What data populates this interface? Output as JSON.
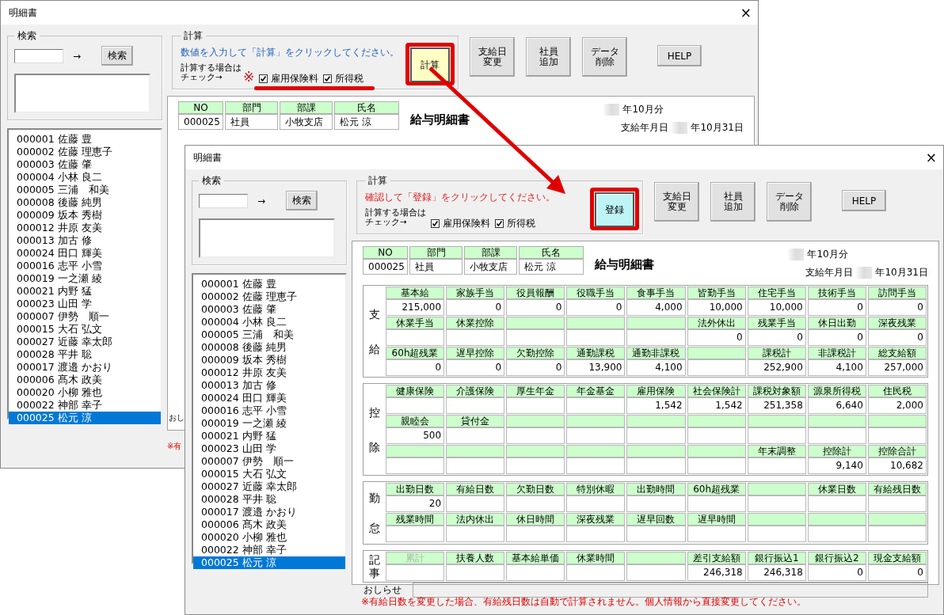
{
  "windows": [
    {
      "title": "明細書",
      "close": "×",
      "search": {
        "label": "検索",
        "arrow": "→",
        "button": "検索"
      },
      "calc": {
        "label": "計算",
        "message": "数値を入力して「計算」をクリックしてください。",
        "check_label": [
          "計算する場合は",
          "チェック→"
        ],
        "mark": "※",
        "underline": true,
        "checks": [
          {
            "label": "雇用保険料",
            "checked": true
          },
          {
            "label": "所得税",
            "checked": true
          }
        ],
        "action": {
          "label": "計算",
          "kind": "calc",
          "highlighted": true
        }
      },
      "buttons": [
        {
          "lines": [
            "支給日",
            "変更"
          ]
        },
        {
          "lines": [
            "社員",
            "追加"
          ]
        },
        {
          "lines": [
            "データ",
            "削除"
          ]
        },
        {
          "lines": [
            "HELP"
          ]
        }
      ],
      "employees": [
        {
          "label": "000001 佐藤 豊",
          "selected": false
        },
        {
          "label": "000002 佐藤 理恵子",
          "selected": false
        },
        {
          "label": "000003 佐藤 肇",
          "selected": false
        },
        {
          "label": "000004 小林 良二",
          "selected": false
        },
        {
          "label": "000005 三浦　和美",
          "selected": false
        },
        {
          "label": "000008 後藤 純男",
          "selected": false
        },
        {
          "label": "000009 坂本 秀樹",
          "selected": false
        },
        {
          "label": "000012 井原 友美",
          "selected": false
        },
        {
          "label": "000013 加古 修",
          "selected": false
        },
        {
          "label": "000024 田口 輝美",
          "selected": false
        },
        {
          "label": "000016 志平 小雪",
          "selected": false
        },
        {
          "label": "000019 一之瀬 綾",
          "selected": false
        },
        {
          "label": "000021 内野 猛",
          "selected": false
        },
        {
          "label": "000023 山田 学",
          "selected": false
        },
        {
          "label": "000007 伊勢　順一",
          "selected": false
        },
        {
          "label": "000015 大石 弘文",
          "selected": false
        },
        {
          "label": "000027 近藤 幸太郎",
          "selected": false
        },
        {
          "label": "000028 平井 聡",
          "selected": false
        },
        {
          "label": "000017 渡邉 かおり",
          "selected": false
        },
        {
          "label": "000006 髙木 政美",
          "selected": false
        },
        {
          "label": "000020 小柳 雅也",
          "selected": false
        },
        {
          "label": "000022 神部 幸子",
          "selected": false
        },
        {
          "label": "000025 松元 涼",
          "selected": true
        }
      ],
      "slip": {
        "header": [
          {
            "label": "NO",
            "value": "000025"
          },
          {
            "label": "部門",
            "value": "社員"
          },
          {
            "label": "部課",
            "value": "小牧支店"
          },
          {
            "label": "氏名",
            "value": "松元 涼"
          }
        ],
        "title": "給与明細書",
        "period": "年10月分",
        "pay_date_label": "支給年月日",
        "pay_date": "年10月31日"
      },
      "notice_label": "おし",
      "note": "※有"
    },
    {
      "title": "明細書",
      "close": "×",
      "search": {
        "label": "検索",
        "arrow": "→",
        "button": "検索"
      },
      "calc": {
        "label": "計算",
        "message": "確認して「登録」をクリックしてください。",
        "check_label": [
          "計算する場合は",
          "チェック→"
        ],
        "underline": false,
        "checks": [
          {
            "label": "雇用保険料",
            "checked": true
          },
          {
            "label": "所得税",
            "checked": true
          }
        ],
        "action": {
          "label": "登録",
          "kind": "register",
          "highlighted": true
        }
      },
      "buttons": [
        {
          "lines": [
            "支給日",
            "変更"
          ]
        },
        {
          "lines": [
            "社員",
            "追加"
          ]
        },
        {
          "lines": [
            "データ",
            "削除"
          ]
        },
        {
          "lines": [
            "HELP"
          ]
        }
      ],
      "employees": [
        {
          "label": "000001 佐藤 豊",
          "selected": false
        },
        {
          "label": "000002 佐藤 理恵子",
          "selected": false
        },
        {
          "label": "000003 佐藤 肇",
          "selected": false
        },
        {
          "label": "000004 小林 良二",
          "selected": false
        },
        {
          "label": "000005 三浦　和美",
          "selected": false
        },
        {
          "label": "000008 後藤 純男",
          "selected": false
        },
        {
          "label": "000009 坂本 秀樹",
          "selected": false
        },
        {
          "label": "000012 井原 友美",
          "selected": false
        },
        {
          "label": "000013 加古 修",
          "selected": false
        },
        {
          "label": "000024 田口 輝美",
          "selected": false
        },
        {
          "label": "000016 志平 小雪",
          "selected": false
        },
        {
          "label": "000019 一之瀬 綾",
          "selected": false
        },
        {
          "label": "000021 内野 猛",
          "selected": false
        },
        {
          "label": "000023 山田 学",
          "selected": false
        },
        {
          "label": "000007 伊勢　順一",
          "selected": false
        },
        {
          "label": "000015 大石 弘文",
          "selected": false
        },
        {
          "label": "000027 近藤 幸太郎",
          "selected": false
        },
        {
          "label": "000028 平井 聡",
          "selected": false
        },
        {
          "label": "000017 渡邉 かおり",
          "selected": false
        },
        {
          "label": "000006 髙木 政美",
          "selected": false
        },
        {
          "label": "000020 小柳 雅也",
          "selected": false
        },
        {
          "label": "000022 神部 幸子",
          "selected": false
        },
        {
          "label": "000025 松元 涼",
          "selected": true
        }
      ],
      "slip": {
        "header": [
          {
            "label": "NO",
            "value": "000025"
          },
          {
            "label": "部門",
            "value": "社員"
          },
          {
            "label": "部課",
            "value": "小牧支店"
          },
          {
            "label": "氏名",
            "value": "松元 涼"
          }
        ],
        "title": "給与明細書",
        "period": "年10月分",
        "pay_date_label": "支給年月日",
        "pay_date": "年10月31日"
      },
      "sections": [
        {
          "label": "支給",
          "rows": [
            {
              "cells": [
                {
                  "label": "基本給",
                  "value": "215,000"
                },
                {
                  "label": "家族手当",
                  "value": "0"
                },
                {
                  "label": "役員報酬",
                  "value": "0"
                },
                {
                  "label": "役職手当",
                  "value": "0"
                },
                {
                  "label": "食事手当",
                  "value": "4,000"
                },
                {
                  "label": "皆勤手当",
                  "value": "10,000"
                },
                {
                  "label": "住宅手当",
                  "value": "10,000"
                },
                {
                  "label": "技術手当",
                  "value": "0"
                },
                {
                  "label": "訪問手当",
                  "value": "0"
                }
              ]
            },
            {
              "cells": [
                {
                  "label": "休業手当"
                },
                {
                  "label": "休業控除"
                },
                {},
                {},
                {},
                {
                  "label": "法外休出",
                  "value": "0"
                },
                {
                  "label": "残業手当",
                  "value": "0"
                },
                {
                  "label": "休日出勤",
                  "value": "0"
                },
                {
                  "label": "深夜残業",
                  "value": "0"
                }
              ]
            },
            {
              "cells": [
                {
                  "label": "60h超残業",
                  "value": "0"
                },
                {
                  "label": "遅早控除",
                  "value": "0"
                },
                {
                  "label": "欠勤控除",
                  "value": "0"
                },
                {
                  "label": "通勤課税",
                  "value": "13,900"
                },
                {
                  "label": "通勤非課税",
                  "value": "4,100"
                },
                {},
                {
                  "label": "課税計",
                  "value": "252,900"
                },
                {
                  "label": "非課税計",
                  "value": "4,100"
                },
                {
                  "label": "総支給額",
                  "value": "257,000"
                }
              ]
            }
          ]
        },
        {
          "label": "控除",
          "rows": [
            {
              "cells": [
                {
                  "label": "健康保険"
                },
                {
                  "label": "介護保険"
                },
                {
                  "label": "厚生年金"
                },
                {
                  "label": "年金基金"
                },
                {
                  "label": "雇用保険",
                  "value": "1,542"
                },
                {
                  "label": "社会保険計",
                  "value": "1,542"
                },
                {
                  "label": "課税対象額",
                  "value": "251,358"
                },
                {
                  "label": "源泉所得税",
                  "value": "6,640"
                },
                {
                  "label": "住民税",
                  "value": "2,000"
                }
              ]
            },
            {
              "cells": [
                {
                  "label": "親睦会",
                  "value": "500"
                },
                {
                  "label": "貸付金"
                },
                {},
                {},
                {},
                {},
                {},
                {},
                {}
              ]
            },
            {
              "cells": [
                {},
                {},
                {},
                {},
                {},
                {},
                {
                  "label": "年末調整"
                },
                {
                  "label": "控除計",
                  "value": "9,140"
                },
                {
                  "label": "控除合計",
                  "value": "10,682"
                }
              ]
            }
          ]
        },
        {
          "label": "勤怠",
          "rows": [
            {
              "cells": [
                {
                  "label": "出勤日数",
                  "value": "20"
                },
                {
                  "label": "有給日数"
                },
                {
                  "label": "欠勤日数"
                },
                {
                  "label": "特別休暇"
                },
                {
                  "label": "出勤時間"
                },
                {
                  "label": "60h超残業"
                },
                {},
                {
                  "label": "休業日数"
                },
                {
                  "label": "有給残日数"
                }
              ]
            },
            {
              "cells": [
                {
                  "label": "残業時間"
                },
                {
                  "label": "法内休出"
                },
                {
                  "label": "休日時間"
                },
                {
                  "label": "深夜残業"
                },
                {
                  "label": "遅早回数"
                },
                {
                  "label": "遅早時間"
                },
                {},
                {},
                {}
              ]
            }
          ]
        },
        {
          "label": "記事",
          "rows": [
            {
              "cells": [
                {
                  "label": "累計",
                  "disabled": true
                },
                {
                  "label": "扶養人数",
                  "disabled": false
                },
                {
                  "label": "基本給単価",
                  "disabled": false
                },
                {
                  "label": "休業時間",
                  "disabled": false
                },
                {},
                {
                  "label": "差引支給額",
                  "value": "246,318",
                  "disabled": false
                },
                {
                  "label": "銀行振込1",
                  "value": "246,318",
                  "disabled": false
                },
                {
                  "label": "銀行振込2",
                  "value": "0",
                  "disabled": false
                },
                {
                  "label": "現金支給額",
                  "value": "0",
                  "disabled": false
                }
              ]
            }
          ]
        }
      ],
      "notice_label": "おしらせ",
      "note": "※有給日数を変更した場合、有給残日数は自動で計算されません。個人情報から直接変更してください。"
    }
  ],
  "annotations": [
    {
      "kind": "arrow"
    }
  ]
}
